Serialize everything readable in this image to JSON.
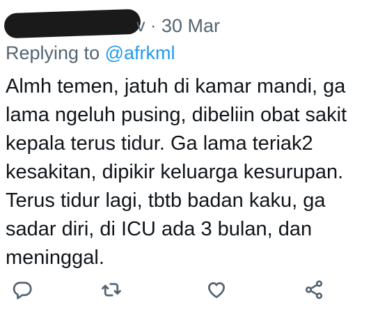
{
  "header": {
    "handle_tail": "v",
    "separator": "·",
    "date": "30 Mar"
  },
  "reply": {
    "prefix": "Replying to ",
    "mention": "@afrkml"
  },
  "tweet": {
    "lines": [
      "Almh temen, jatuh di kamar mandi, ga",
      "lama ngeluh pusing, dibeliin obat sakit",
      "kepala terus tidur. Ga lama teriak2",
      "kesakitan, dipikir keluarga kesurupan.",
      "Terus tidur lagi, tbtb badan kaku, ga",
      "sadar diri, di ICU ada 3 bulan, dan",
      "meninggal."
    ]
  },
  "actions": [
    {
      "icon": "reply-icon"
    },
    {
      "icon": "retweet-icon"
    },
    {
      "icon": "like-icon"
    },
    {
      "icon": "share-icon"
    }
  ],
  "colors": {
    "text": "#0f1419",
    "secondary": "#536471",
    "accent": "#1d9bf0",
    "redaction": "#1a1a1a"
  }
}
